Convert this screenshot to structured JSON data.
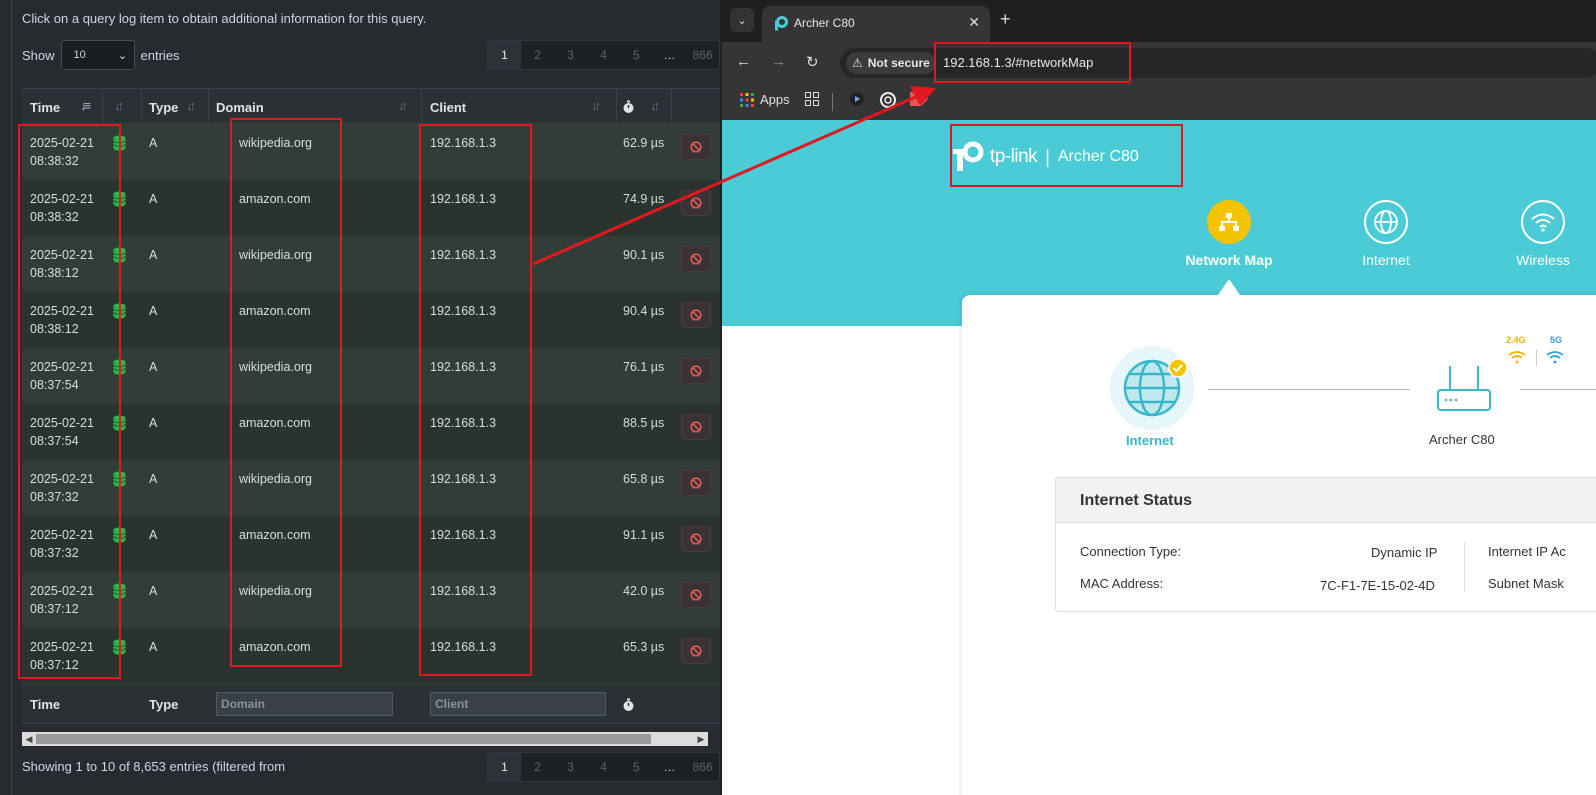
{
  "left": {
    "hint": "Click on a query log item to obtain additional information for this query.",
    "show_label": "Show",
    "entries_label": "entries",
    "page_size": "10",
    "pagination": [
      "1",
      "2",
      "3",
      "4",
      "5",
      "…",
      "866"
    ],
    "columns": {
      "time": "Time",
      "type": "Type",
      "domain": "Domain",
      "client": "Client"
    },
    "rows": [
      {
        "date": "2025-02-21",
        "time": "08:38:32",
        "type": "A",
        "domain": "wikipedia.org",
        "client": "192.168.1.3",
        "duration": "62.9 µs"
      },
      {
        "date": "2025-02-21",
        "time": "08:38:32",
        "type": "A",
        "domain": "amazon.com",
        "client": "192.168.1.3",
        "duration": "74.9 µs"
      },
      {
        "date": "2025-02-21",
        "time": "08:38:12",
        "type": "A",
        "domain": "wikipedia.org",
        "client": "192.168.1.3",
        "duration": "90.1 µs"
      },
      {
        "date": "2025-02-21",
        "time": "08:38:12",
        "type": "A",
        "domain": "amazon.com",
        "client": "192.168.1.3",
        "duration": "90.4 µs"
      },
      {
        "date": "2025-02-21",
        "time": "08:37:54",
        "type": "A",
        "domain": "wikipedia.org",
        "client": "192.168.1.3",
        "duration": "76.1 µs"
      },
      {
        "date": "2025-02-21",
        "time": "08:37:54",
        "type": "A",
        "domain": "amazon.com",
        "client": "192.168.1.3",
        "duration": "88.5 µs"
      },
      {
        "date": "2025-02-21",
        "time": "08:37:32",
        "type": "A",
        "domain": "wikipedia.org",
        "client": "192.168.1.3",
        "duration": "65.8 µs"
      },
      {
        "date": "2025-02-21",
        "time": "08:37:32",
        "type": "A",
        "domain": "amazon.com",
        "client": "192.168.1.3",
        "duration": "91.1 µs"
      },
      {
        "date": "2025-02-21",
        "time": "08:37:12",
        "type": "A",
        "domain": "wikipedia.org",
        "client": "192.168.1.3",
        "duration": "42.0 µs"
      },
      {
        "date": "2025-02-21",
        "time": "08:37:12",
        "type": "A",
        "domain": "amazon.com",
        "client": "192.168.1.3",
        "duration": "65.3 µs"
      }
    ],
    "footer": {
      "time": "Time",
      "type": "Type",
      "domain_placeholder": "Domain",
      "client_placeholder": "Client"
    },
    "showing_text": "Showing 1 to 10 of 8,653 entries (filtered from"
  },
  "browser": {
    "tab_title": "Archer C80",
    "security_chip": "Not secure",
    "url": "192.168.1.3/#networkMap",
    "bookmarks": {
      "apps": "Apps"
    }
  },
  "router": {
    "brand": "tp-link",
    "model": "Archer C80",
    "nav": [
      {
        "label": "Network Map"
      },
      {
        "label": "Internet"
      },
      {
        "label": "Wireless"
      }
    ],
    "map": {
      "internet_label": "Internet",
      "router_label": "Archer C80",
      "band_24": "2.4G",
      "band_5": "5G"
    },
    "status": {
      "title": "Internet Status",
      "connection_type_label": "Connection Type:",
      "connection_type_value": "Dynamic IP",
      "mac_label": "MAC Address:",
      "mac_value": "7C-F1-7E-15-02-4D",
      "ip_label": "Internet IP Ac",
      "subnet_label": "Subnet Mask"
    }
  },
  "colors": {
    "annotation_red": "#e1191f",
    "tplink_teal": "#4acbd6",
    "accent_yellow": "#f5c400"
  }
}
